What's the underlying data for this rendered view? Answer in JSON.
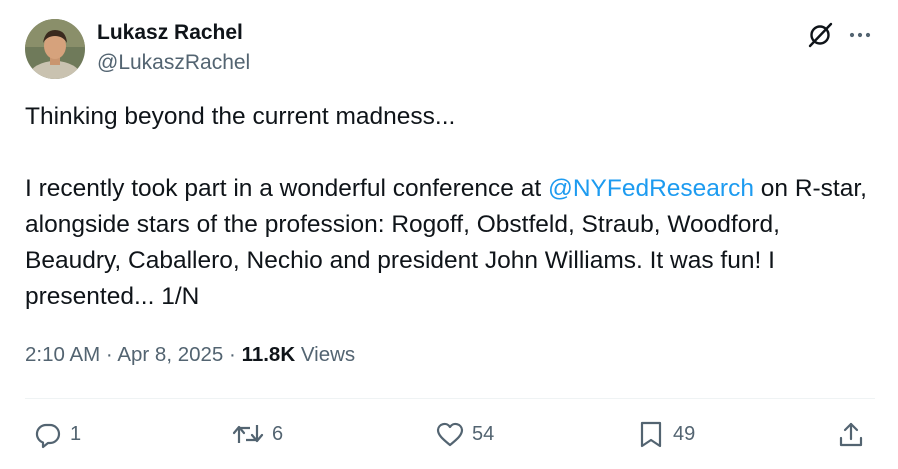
{
  "author": {
    "name": "Lukasz Rachel",
    "handle": "@LukaszRachel"
  },
  "tweet": {
    "line_1": "Thinking beyond the current madness...",
    "para_2_before": "I recently took part in a wonderful conference at ",
    "mention": "@NYFedResearch",
    "para_2_after": " on R-star, alongside stars of the profession: Rogoff, Obstfeld, Straub, Woodford, Beaudry, Caballero, Nechio and president John Williams. It was fun! I presented... 1/N"
  },
  "meta": {
    "time": "2:10 AM",
    "separator": "·",
    "date": "Apr 8, 2025",
    "views_count": "11.8K",
    "views_label": "Views"
  },
  "actions": {
    "replies": "1",
    "reposts": "6",
    "likes": "54",
    "bookmarks": "49"
  },
  "icons": {
    "grok": "grok-icon",
    "more": "more-icon",
    "reply": "reply-icon",
    "repost": "repost-icon",
    "like": "heart-icon",
    "bookmark": "bookmark-icon",
    "share": "share-icon"
  },
  "colors": {
    "text": "#0f1419",
    "secondary": "#536471",
    "link": "#1d9bf0",
    "divider": "#eff3f4"
  }
}
